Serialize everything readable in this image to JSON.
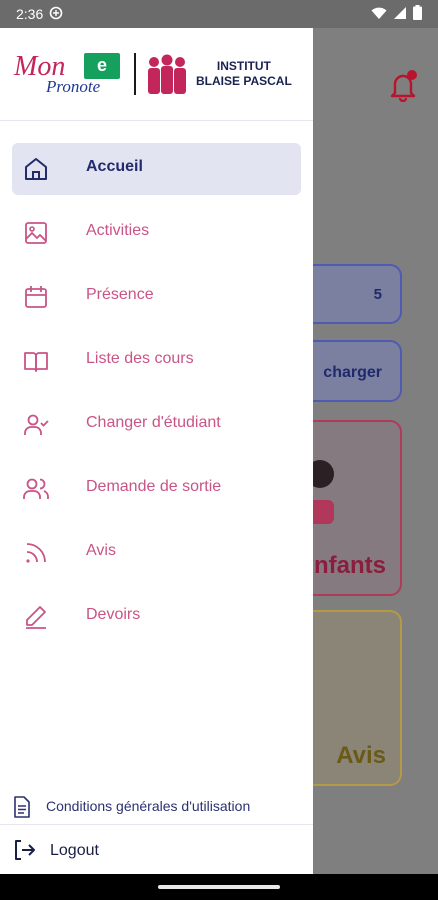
{
  "status_bar": {
    "time": "2:36"
  },
  "drawer": {
    "logo": {
      "mon": "Mon",
      "pronote": "Pronote",
      "e": "e",
      "school_line1": "INSTITUT",
      "school_line2": "BLAISE PASCAL"
    },
    "menu": [
      {
        "label": "Accueil",
        "icon": "home-icon",
        "active": true
      },
      {
        "label": "Activities",
        "icon": "image-icon",
        "active": false
      },
      {
        "label": "Présence",
        "icon": "calendar-icon",
        "active": false
      },
      {
        "label": "Liste des cours",
        "icon": "book-icon",
        "active": false
      },
      {
        "label": "Changer d'étudiant",
        "icon": "user-check-icon",
        "active": false
      },
      {
        "label": "Demande de sortie",
        "icon": "users-icon",
        "active": false
      },
      {
        "label": "Avis",
        "icon": "rss-icon",
        "active": false
      },
      {
        "label": "Devoirs",
        "icon": "pen-icon",
        "active": false
      }
    ],
    "terms_label": "Conditions générales d'utilisation",
    "logout_label": "Logout"
  },
  "background": {
    "stat_value": "5",
    "download_label": "charger",
    "kids_label": "nfants",
    "avis_label": "Avis"
  },
  "colors": {
    "accent_pink": "#c95486",
    "active_bg": "#e2e4f2",
    "active_text": "#232b6a",
    "bell_red": "#b8142e"
  }
}
